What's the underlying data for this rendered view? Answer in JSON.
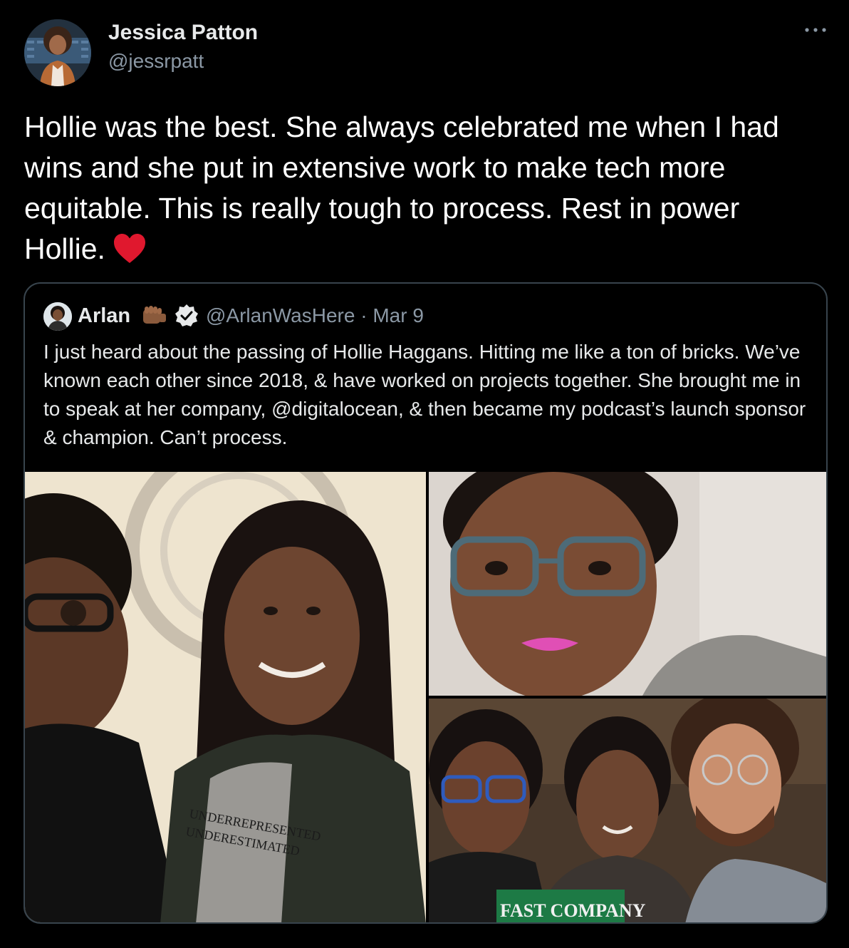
{
  "tweet": {
    "author_name": "Jessica Patton",
    "author_handle": "@jessrpatt",
    "avatar_icon": "profile-photo",
    "more_icon": "more-options-icon",
    "text": "Hollie was the best. She always celebrated me when I had wins and she put in extensive work to make tech more equitable. This is really tough to process. Rest in power Hollie.",
    "emoji": "heart-icon",
    "colors": {
      "background": "#000000",
      "text": "#ffffff",
      "secondary": "#8b98a5",
      "border": "#38444d",
      "heart": "#e0182e"
    }
  },
  "quoted_tweet": {
    "author_name": "Arlan",
    "author_emoji": "fist-icon",
    "verified_icon": "verified-badge-icon",
    "meta": "@ArlanWasHere · Mar 9",
    "text": "I just heard about the passing of Hollie Haggans. Hitting me like a ton of bricks. We’ve known each other since 2018, & have worked on projects together. She brought me in to speak at her company, @digitalocean, & then became my podcast’s launch sponsor & champion. Can’t process.",
    "photos": [
      {
        "name": "two-women-photo",
        "shirt_text": [
          "UNDERREPRESENTED",
          "UNDERESTIMATED"
        ]
      },
      {
        "name": "woman-glasses-selfie"
      },
      {
        "name": "three-people-selfie",
        "magazine_text": "FAST COMPANY"
      }
    ]
  }
}
